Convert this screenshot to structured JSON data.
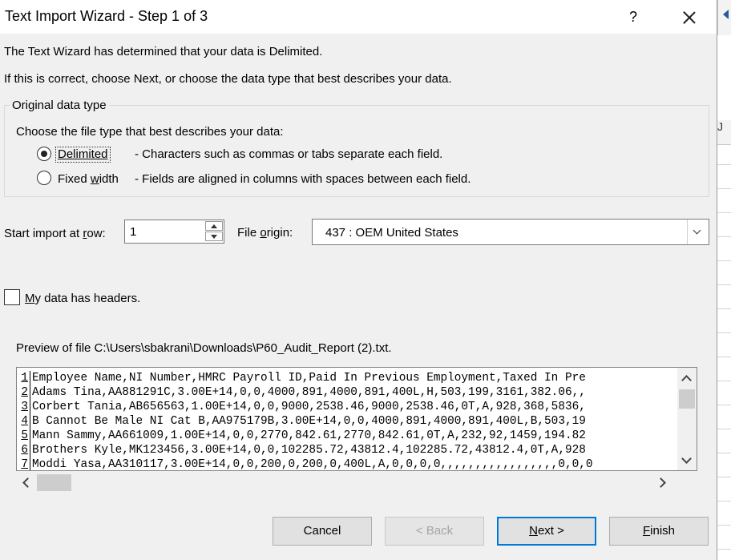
{
  "window": {
    "title": "Text Import Wizard - Step 1 of 3",
    "help_label": "?"
  },
  "intro": {
    "line1": "The Text Wizard has determined that your data is Delimited.",
    "line2": "If this is correct, choose Next, or choose the data type that best describes your data."
  },
  "original_data_type": {
    "legend": "Original data type",
    "prompt": "Choose the file type that best describes your data:",
    "options": [
      {
        "label": "Delimited",
        "description": "- Characters such as commas or tabs separate each field.",
        "selected": true
      },
      {
        "label": "Fixed width",
        "label_pre": "Fixed ",
        "label_u": "w",
        "label_post": "idth",
        "description": "- Fields are aligned in columns with spaces between each field.",
        "selected": false
      }
    ]
  },
  "start_row": {
    "label_pre": "Start import at ",
    "label_u": "r",
    "label_post": "ow:",
    "value": "1"
  },
  "file_origin": {
    "label_pre": "File ",
    "label_u": "o",
    "label_post": "rigin:",
    "value": "437 : OEM United States"
  },
  "headers_checkbox": {
    "label_u": "M",
    "label_post": "y data has headers.",
    "checked": false
  },
  "preview": {
    "label": "Preview of file C:\\Users\\sbakrani\\Downloads\\P60_Audit_Report (2).txt.",
    "line_numbers": [
      "1",
      "2",
      "3",
      "4",
      "5",
      "6",
      "7"
    ],
    "lines": [
      "Employee Name,NI Number,HMRC Payroll ID,Paid In Previous Employment,Taxed In Pre",
      "Adams Tina,AA881291C,3.00E+14,0,0,4000,891,4000,891,400L,H,503,199,3161,382.06,,",
      "Corbert Tania,AB656563,1.00E+14,0,0,9000,2538.46,9000,2538.46,0T,A,928,368,5836,",
      "B Cannot Be Male NI Cat B,AA975179B,3.00E+14,0,0,4000,891,4000,891,400L,B,503,19",
      "Mann Sammy,AA661009,1.00E+14,0,0,2770,842.61,2770,842.61,0T,A,232,92,1459,194.82",
      "Brothers Kyle,MK123456,3.00E+14,0,0,102285.72,43812.4,102285.72,43812.4,0T,A,928",
      "Moddi Yasa,AA310117,3.00E+14,0,0,200,0,200,0,400L,A,0,0,0,0,,,,,,,,,,,,,,,,,0,0,0"
    ]
  },
  "buttons": {
    "cancel": "Cancel",
    "back": "< Back",
    "next_u": "N",
    "next_post": "ext >",
    "finish_u": "F",
    "finish_post": "inish"
  },
  "background": {
    "column_header": "J"
  }
}
